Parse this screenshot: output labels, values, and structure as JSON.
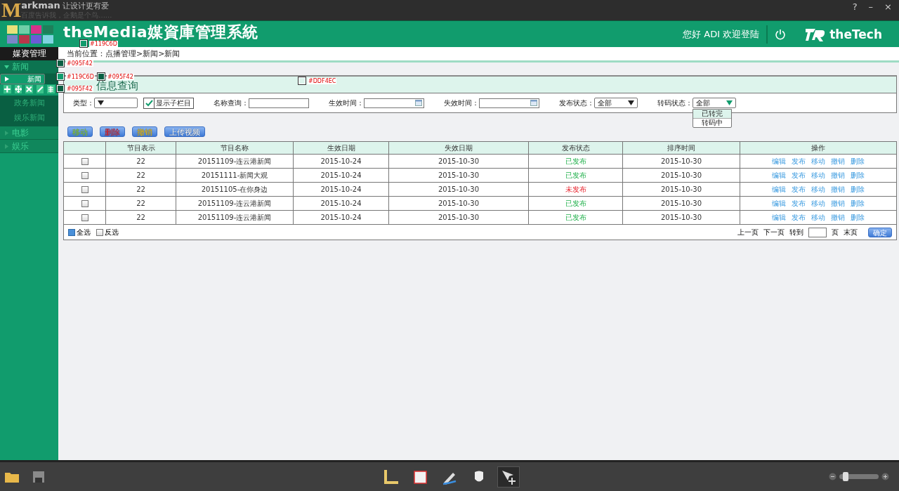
{
  "markman": {
    "mark": "M",
    "name": "arkman",
    "slogan": "让设计更有爱",
    "subtitle": "百度告诉我，企鹅是个鸟......",
    "controls": [
      "?",
      "–",
      "×"
    ]
  },
  "header": {
    "title": "theMedia媒資庫管理系統",
    "greeting": "您好 ADI 欢迎登陆",
    "brand": "theTech"
  },
  "sidebar": {
    "title": "媒资管理",
    "groups": [
      {
        "label": "新闻",
        "expanded": true,
        "children": [
          {
            "label": "新闻",
            "selected": true
          },
          {
            "label": "政务新闻",
            "selected": false
          },
          {
            "label": "娱乐新闻",
            "selected": false
          }
        ]
      },
      {
        "label": "电影",
        "expanded": false
      },
      {
        "label": "娱乐",
        "expanded": false
      }
    ]
  },
  "breadcrumb": "当前位置：点播管理>新闻>新闻",
  "panel": {
    "title": "信息查询"
  },
  "filters": [
    {
      "kind": "select",
      "label": "类型："
    },
    {
      "kind": "checkbox",
      "label": "显示子栏目",
      "checked": true
    },
    {
      "kind": "text",
      "label": "名称查询："
    },
    {
      "kind": "date",
      "label": "生效时间："
    },
    {
      "kind": "date",
      "label": "失效时间："
    },
    {
      "kind": "select",
      "label": "发布状态：",
      "value": "全部",
      "expanded": false
    },
    {
      "kind": "select",
      "label": "转码状态：",
      "value": "全部",
      "expanded": true,
      "options": [
        {
          "label": "已转完",
          "selected": true
        },
        {
          "label": "转码中",
          "selected": false
        }
      ]
    }
  ],
  "buttons": [
    {
      "label": "移动",
      "kind": "move"
    },
    {
      "label": "删除",
      "kind": "delete"
    },
    {
      "label": "撤销",
      "kind": "revoke"
    },
    {
      "label": "上传视频",
      "kind": "upload"
    }
  ],
  "table": {
    "columns": [
      "节目表示",
      "节目名称",
      "生效日期",
      "失效日期",
      "发布状态",
      "排序时间",
      "操作"
    ],
    "rows": [
      {
        "checked": false,
        "id": "22",
        "name": "20151109-连云港新闻",
        "start": "2015-10-24",
        "end": "2015-10-30",
        "status": "已发布",
        "published": true,
        "sort_time": "2015-10-30",
        "actions": [
          "编辑",
          "发布",
          "移动",
          "撤销",
          "删除"
        ]
      },
      {
        "checked": false,
        "id": "22",
        "name": "20151111-新闻大观",
        "start": "2015-10-24",
        "end": "2015-10-30",
        "status": "已发布",
        "published": true,
        "sort_time": "2015-10-30",
        "actions": [
          "编辑",
          "发布",
          "移动",
          "撤销",
          "删除"
        ]
      },
      {
        "checked": false,
        "id": "22",
        "name": "20151105-在你身边",
        "start": "2015-10-24",
        "end": "2015-10-30",
        "status": "未发布",
        "published": false,
        "sort_time": "2015-10-30",
        "actions": [
          "编辑",
          "发布",
          "移动",
          "撤销",
          "删除"
        ]
      },
      {
        "checked": false,
        "id": "22",
        "name": "20151109-连云港新闻",
        "start": "2015-10-24",
        "end": "2015-10-30",
        "status": "已发布",
        "published": true,
        "sort_time": "2015-10-30",
        "actions": [
          "编辑",
          "发布",
          "移动",
          "撤销",
          "删除"
        ]
      },
      {
        "checked": false,
        "id": "22",
        "name": "20151109-连云港新闻",
        "start": "2015-10-24",
        "end": "2015-10-30",
        "status": "已发布",
        "published": true,
        "sort_time": "2015-10-30",
        "actions": [
          "编辑",
          "发布",
          "移动",
          "撤销",
          "删除"
        ]
      }
    ]
  },
  "footer": {
    "select_all": {
      "label": "全选",
      "checked": true
    },
    "invert": {
      "label": "反选",
      "checked": false
    },
    "pager": {
      "prev": "上一页",
      "next": "下一页",
      "goto": "转到",
      "unit": "页",
      "last": "末页",
      "confirm": "确定"
    }
  },
  "annotations": [
    {
      "text": "#119C6D",
      "color": "#119c6d"
    },
    {
      "text": "#095F42",
      "color": "#095f42"
    },
    {
      "text": "#119C6D",
      "color": "#119c6d"
    },
    {
      "text": "#095F42",
      "color": "#095f42"
    },
    {
      "text": "#095F42",
      "color": "#095f42"
    },
    {
      "text": "#DDF4EC",
      "color": "#ddf4ec"
    }
  ],
  "toolbar": {
    "tools": [
      {
        "selected": false
      },
      {
        "selected": false
      },
      {
        "selected": false
      },
      {
        "selected": false
      },
      {
        "selected": true
      }
    ],
    "zoom": {
      "level": 0.1
    }
  }
}
